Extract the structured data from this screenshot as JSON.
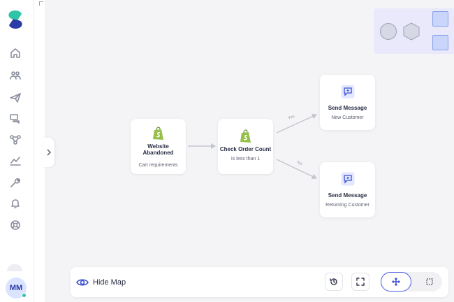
{
  "sidebar": {
    "logo": "brand-logo",
    "items": [
      {
        "name": "home",
        "icon": "home-icon"
      },
      {
        "name": "audiences",
        "icon": "users-icon"
      },
      {
        "name": "campaigns",
        "icon": "paper-plane-icon"
      },
      {
        "name": "conversations",
        "icon": "chat-icon"
      },
      {
        "name": "flows",
        "icon": "flow-icon"
      },
      {
        "name": "analytics",
        "icon": "chart-icon"
      },
      {
        "name": "settings",
        "icon": "wrench-icon"
      },
      {
        "name": "notifications",
        "icon": "bell-icon"
      },
      {
        "name": "help",
        "icon": "lifebuoy-icon"
      }
    ],
    "user_initials": "MM",
    "status_color": "#2ec4a6"
  },
  "flow": {
    "nodes": [
      {
        "id": "trigger",
        "icon": "shopify-icon",
        "title_line1": "Website",
        "title_line2": "Abandoned",
        "subtitle": "Cart requirements"
      },
      {
        "id": "condition",
        "icon": "shopify-icon",
        "title_line1": "Check Order Count",
        "title_line2": "",
        "subtitle": "Is less than 1"
      },
      {
        "id": "msg-new",
        "icon": "message-icon",
        "title_line1": "Send Message",
        "title_line2": "",
        "subtitle": "New Customer"
      },
      {
        "id": "msg-returning",
        "icon": "message-icon",
        "title_line1": "Send Message",
        "title_line2": "",
        "subtitle": "Returning Customer"
      }
    ],
    "edges": [
      {
        "from": "trigger",
        "to": "condition",
        "label": ""
      },
      {
        "from": "condition",
        "to": "msg-new",
        "label": "Yes"
      },
      {
        "from": "condition",
        "to": "msg-returning",
        "label": "No"
      }
    ]
  },
  "minimap": {
    "shapes": [
      "circle",
      "hexagon",
      "square",
      "square"
    ],
    "background": "#e9e9fb"
  },
  "toolbar": {
    "hide_map_label": "Hide Map",
    "history_icon": "history-icon",
    "fullscreen_icon": "fullscreen-icon",
    "mode_active": "pan",
    "modes": [
      "pan",
      "select"
    ]
  },
  "colors": {
    "accent": "#3b4fd1",
    "shopify_green": "#95bf47",
    "canvas": "#f4f4f6"
  }
}
